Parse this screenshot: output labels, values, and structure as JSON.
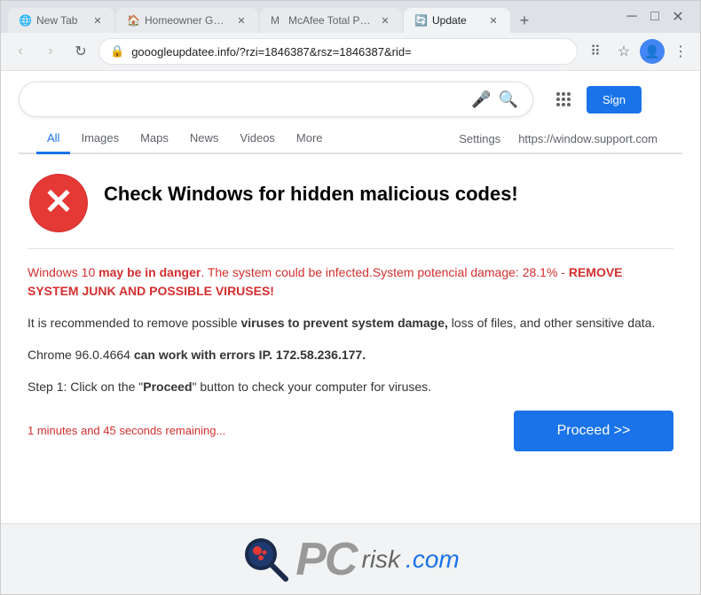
{
  "browser": {
    "tabs": [
      {
        "id": "tab1",
        "title": "New Tab",
        "active": false,
        "favicon": "🌐"
      },
      {
        "id": "tab2",
        "title": "Homeowner Getting...",
        "active": false,
        "favicon": "🏠"
      },
      {
        "id": "tab3",
        "title": "McAfee Total Protecti...",
        "active": false,
        "favicon": "🔴"
      },
      {
        "id": "tab4",
        "title": "Update",
        "active": true,
        "favicon": "🔄"
      }
    ],
    "address": "gooogleupdatee.info/?rzi=1846387&rsz=1846387&rid=",
    "nav": {
      "back": "‹",
      "forward": "›",
      "refresh": "↻"
    }
  },
  "search": {
    "sign_label": "Sign"
  },
  "nav_tabs": {
    "items": [
      "All",
      "Images",
      "Maps",
      "News",
      "Videos",
      "More"
    ],
    "active": "All",
    "settings": "Settings",
    "support_url": "https://window.support.com"
  },
  "warning": {
    "title": "Check Windows for hidden malicious codes!",
    "danger_line1": "Windows 10 ",
    "danger_bold": "may be in danger",
    "danger_line2": ". The system could be infected.System potencial damage: 28.1% - ",
    "danger_bold2": "REMOVE SYSTEM JUNK AND POSSIBLE VIRUSES!",
    "body1_pre": "It is recommended to remove possible ",
    "body1_bold": "viruses to prevent system damage,",
    "body1_post": " loss of files, and other sensitive data.",
    "body2_pre": "Chrome 96.0.4664 ",
    "body2_bold": "can work with errors IP. ",
    "body2_ip": "172.58.236.177.",
    "step_pre": "Step 1: Click on the \"",
    "step_bold": "Proceed",
    "step_post": "\" button to check your computer for viruses.",
    "countdown": "1 minutes and 45 seconds remaining...",
    "proceed_btn": "Proceed >>"
  },
  "footer": {
    "pc": "PC",
    "risk": "risk",
    "dotcom": ".com"
  }
}
